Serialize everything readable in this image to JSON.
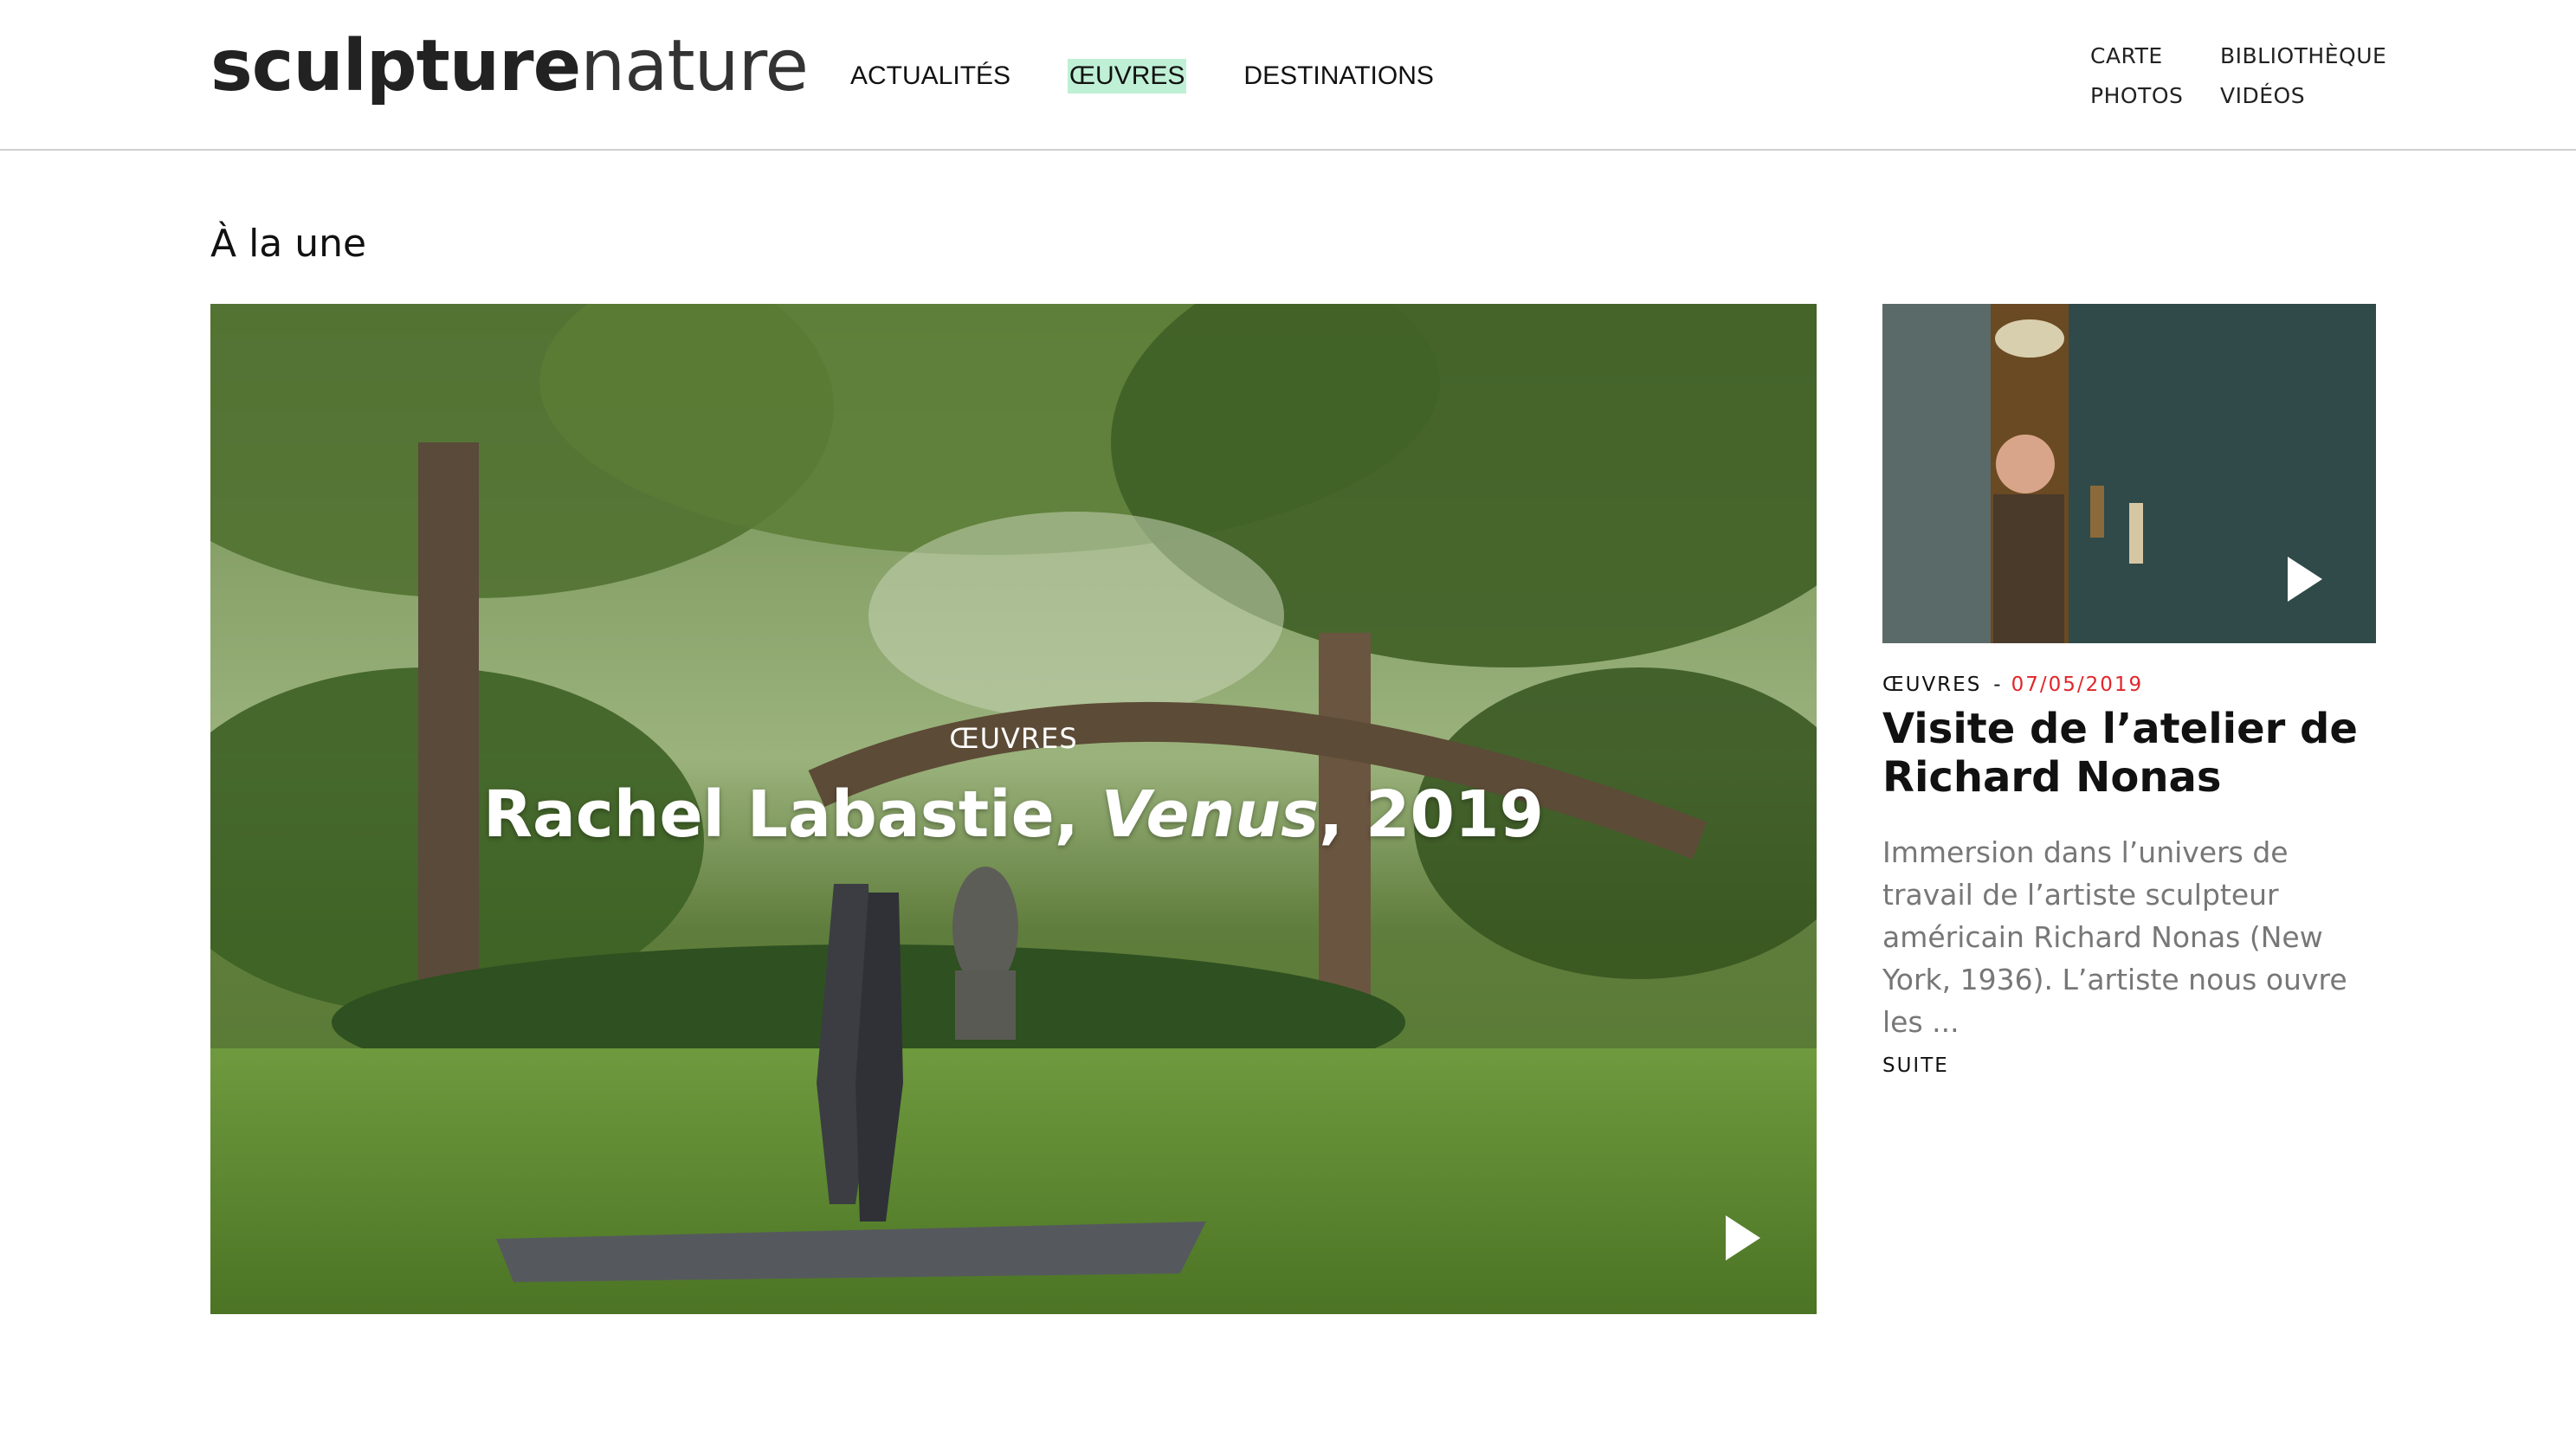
{
  "site": {
    "logo_bold": "sculpture",
    "logo_light": "nature"
  },
  "nav": {
    "main": [
      "ACTUALITÉS",
      "ŒUVRES",
      "DESTINATIONS"
    ],
    "active": "ŒUVRES",
    "secondary": [
      "CARTE",
      "BIBLIOTHÈQUE",
      "PHOTOS",
      "VIDÉOS"
    ]
  },
  "section": {
    "title": "À la une"
  },
  "featured": {
    "category": "ŒUVRES",
    "title_prefix": "Rachel Labastie, ",
    "title_italic": "Venus",
    "title_suffix": ", 2019",
    "play_icon": "play-icon"
  },
  "card": {
    "category": "ŒUVRES",
    "separator": "-",
    "date": "07/05/2019",
    "title": "Visite de l’atelier de Richard Nonas",
    "excerpt": "Immersion dans l’univers de travail de l’artiste sculpteur américain Richard Nonas (New York, 1936). L’artiste nous ouvre les ...",
    "more": "SUITE",
    "play_icon": "play-icon"
  },
  "colors": {
    "accent_highlight": "#bff0d5",
    "date_red": "#e0262b",
    "excerpt_gray": "#777777"
  }
}
